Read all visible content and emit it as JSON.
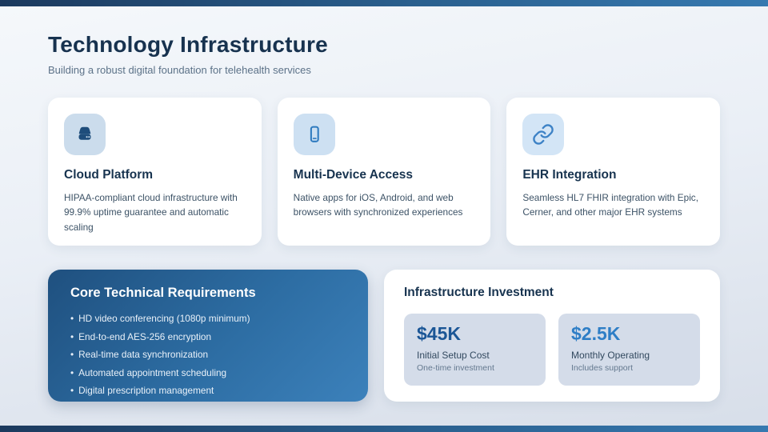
{
  "header": {
    "title": "Technology Infrastructure",
    "subtitle": "Building a robust digital foundation for telehealth services"
  },
  "feature_cards": [
    {
      "icon": "hard-drive-icon",
      "icon_bg": "#cbdcec",
      "title": "Cloud Platform",
      "description": "HIPAA-compliant cloud infrastructure with 99.9% uptime guarantee and automatic scaling"
    },
    {
      "icon": "mobile-icon",
      "icon_bg": "#cde0f2",
      "title": "Multi-Device Access",
      "description": "Native apps for iOS, Android, and web browsers with synchronized experiences"
    },
    {
      "icon": "link-icon",
      "icon_bg": "#d3e5f6",
      "title": "EHR Integration",
      "description": "Seamless HL7 FHIR integration with Epic, Cerner, and other major EHR systems"
    }
  ],
  "requirements": {
    "title": "Core Technical Requirements",
    "bullet": "•",
    "items": [
      "HD video conferencing (1080p minimum)",
      "End-to-end AES-256 encryption",
      "Real-time data synchronization",
      "Automated appointment scheduling",
      "Digital prescription management"
    ]
  },
  "investment": {
    "title": "Infrastructure Investment",
    "stats": [
      {
        "value": "$45K",
        "label": "Initial Setup Cost",
        "sublabel": "One-time investment",
        "value_color": "#1b5696"
      },
      {
        "value": "$2.5K",
        "label": "Monthly Operating",
        "sublabel": "Includes support",
        "value_color": "#2e7ec6"
      }
    ]
  },
  "colors": {
    "accent_bar_dark": "#1c3a5e",
    "accent_bar_light": "#3679b0",
    "title_navy": "#17324f",
    "subtitle_gray": "#5c7288",
    "requirements_gradient_start": "#1f507f",
    "requirements_gradient_end": "#3c81bb",
    "stat_tile_bg": "#d4dce9"
  }
}
